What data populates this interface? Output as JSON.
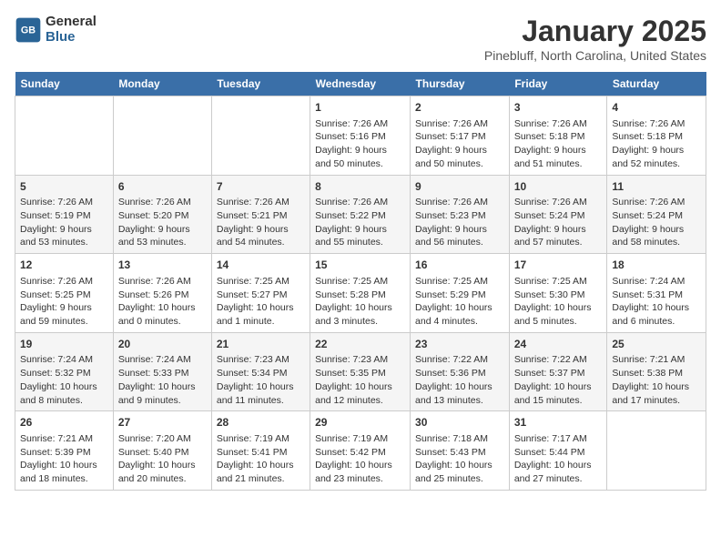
{
  "logo": {
    "general": "General",
    "blue": "Blue"
  },
  "title": "January 2025",
  "subtitle": "Pinebluff, North Carolina, United States",
  "days_of_week": [
    "Sunday",
    "Monday",
    "Tuesday",
    "Wednesday",
    "Thursday",
    "Friday",
    "Saturday"
  ],
  "weeks": [
    [
      {
        "day": "",
        "info": ""
      },
      {
        "day": "",
        "info": ""
      },
      {
        "day": "",
        "info": ""
      },
      {
        "day": "1",
        "info": "Sunrise: 7:26 AM\nSunset: 5:16 PM\nDaylight: 9 hours\nand 50 minutes."
      },
      {
        "day": "2",
        "info": "Sunrise: 7:26 AM\nSunset: 5:17 PM\nDaylight: 9 hours\nand 50 minutes."
      },
      {
        "day": "3",
        "info": "Sunrise: 7:26 AM\nSunset: 5:18 PM\nDaylight: 9 hours\nand 51 minutes."
      },
      {
        "day": "4",
        "info": "Sunrise: 7:26 AM\nSunset: 5:18 PM\nDaylight: 9 hours\nand 52 minutes."
      }
    ],
    [
      {
        "day": "5",
        "info": "Sunrise: 7:26 AM\nSunset: 5:19 PM\nDaylight: 9 hours\nand 53 minutes."
      },
      {
        "day": "6",
        "info": "Sunrise: 7:26 AM\nSunset: 5:20 PM\nDaylight: 9 hours\nand 53 minutes."
      },
      {
        "day": "7",
        "info": "Sunrise: 7:26 AM\nSunset: 5:21 PM\nDaylight: 9 hours\nand 54 minutes."
      },
      {
        "day": "8",
        "info": "Sunrise: 7:26 AM\nSunset: 5:22 PM\nDaylight: 9 hours\nand 55 minutes."
      },
      {
        "day": "9",
        "info": "Sunrise: 7:26 AM\nSunset: 5:23 PM\nDaylight: 9 hours\nand 56 minutes."
      },
      {
        "day": "10",
        "info": "Sunrise: 7:26 AM\nSunset: 5:24 PM\nDaylight: 9 hours\nand 57 minutes."
      },
      {
        "day": "11",
        "info": "Sunrise: 7:26 AM\nSunset: 5:24 PM\nDaylight: 9 hours\nand 58 minutes."
      }
    ],
    [
      {
        "day": "12",
        "info": "Sunrise: 7:26 AM\nSunset: 5:25 PM\nDaylight: 9 hours\nand 59 minutes."
      },
      {
        "day": "13",
        "info": "Sunrise: 7:26 AM\nSunset: 5:26 PM\nDaylight: 10 hours\nand 0 minutes."
      },
      {
        "day": "14",
        "info": "Sunrise: 7:25 AM\nSunset: 5:27 PM\nDaylight: 10 hours\nand 1 minute."
      },
      {
        "day": "15",
        "info": "Sunrise: 7:25 AM\nSunset: 5:28 PM\nDaylight: 10 hours\nand 3 minutes."
      },
      {
        "day": "16",
        "info": "Sunrise: 7:25 AM\nSunset: 5:29 PM\nDaylight: 10 hours\nand 4 minutes."
      },
      {
        "day": "17",
        "info": "Sunrise: 7:25 AM\nSunset: 5:30 PM\nDaylight: 10 hours\nand 5 minutes."
      },
      {
        "day": "18",
        "info": "Sunrise: 7:24 AM\nSunset: 5:31 PM\nDaylight: 10 hours\nand 6 minutes."
      }
    ],
    [
      {
        "day": "19",
        "info": "Sunrise: 7:24 AM\nSunset: 5:32 PM\nDaylight: 10 hours\nand 8 minutes."
      },
      {
        "day": "20",
        "info": "Sunrise: 7:24 AM\nSunset: 5:33 PM\nDaylight: 10 hours\nand 9 minutes."
      },
      {
        "day": "21",
        "info": "Sunrise: 7:23 AM\nSunset: 5:34 PM\nDaylight: 10 hours\nand 11 minutes."
      },
      {
        "day": "22",
        "info": "Sunrise: 7:23 AM\nSunset: 5:35 PM\nDaylight: 10 hours\nand 12 minutes."
      },
      {
        "day": "23",
        "info": "Sunrise: 7:22 AM\nSunset: 5:36 PM\nDaylight: 10 hours\nand 13 minutes."
      },
      {
        "day": "24",
        "info": "Sunrise: 7:22 AM\nSunset: 5:37 PM\nDaylight: 10 hours\nand 15 minutes."
      },
      {
        "day": "25",
        "info": "Sunrise: 7:21 AM\nSunset: 5:38 PM\nDaylight: 10 hours\nand 17 minutes."
      }
    ],
    [
      {
        "day": "26",
        "info": "Sunrise: 7:21 AM\nSunset: 5:39 PM\nDaylight: 10 hours\nand 18 minutes."
      },
      {
        "day": "27",
        "info": "Sunrise: 7:20 AM\nSunset: 5:40 PM\nDaylight: 10 hours\nand 20 minutes."
      },
      {
        "day": "28",
        "info": "Sunrise: 7:19 AM\nSunset: 5:41 PM\nDaylight: 10 hours\nand 21 minutes."
      },
      {
        "day": "29",
        "info": "Sunrise: 7:19 AM\nSunset: 5:42 PM\nDaylight: 10 hours\nand 23 minutes."
      },
      {
        "day": "30",
        "info": "Sunrise: 7:18 AM\nSunset: 5:43 PM\nDaylight: 10 hours\nand 25 minutes."
      },
      {
        "day": "31",
        "info": "Sunrise: 7:17 AM\nSunset: 5:44 PM\nDaylight: 10 hours\nand 27 minutes."
      },
      {
        "day": "",
        "info": ""
      }
    ]
  ]
}
